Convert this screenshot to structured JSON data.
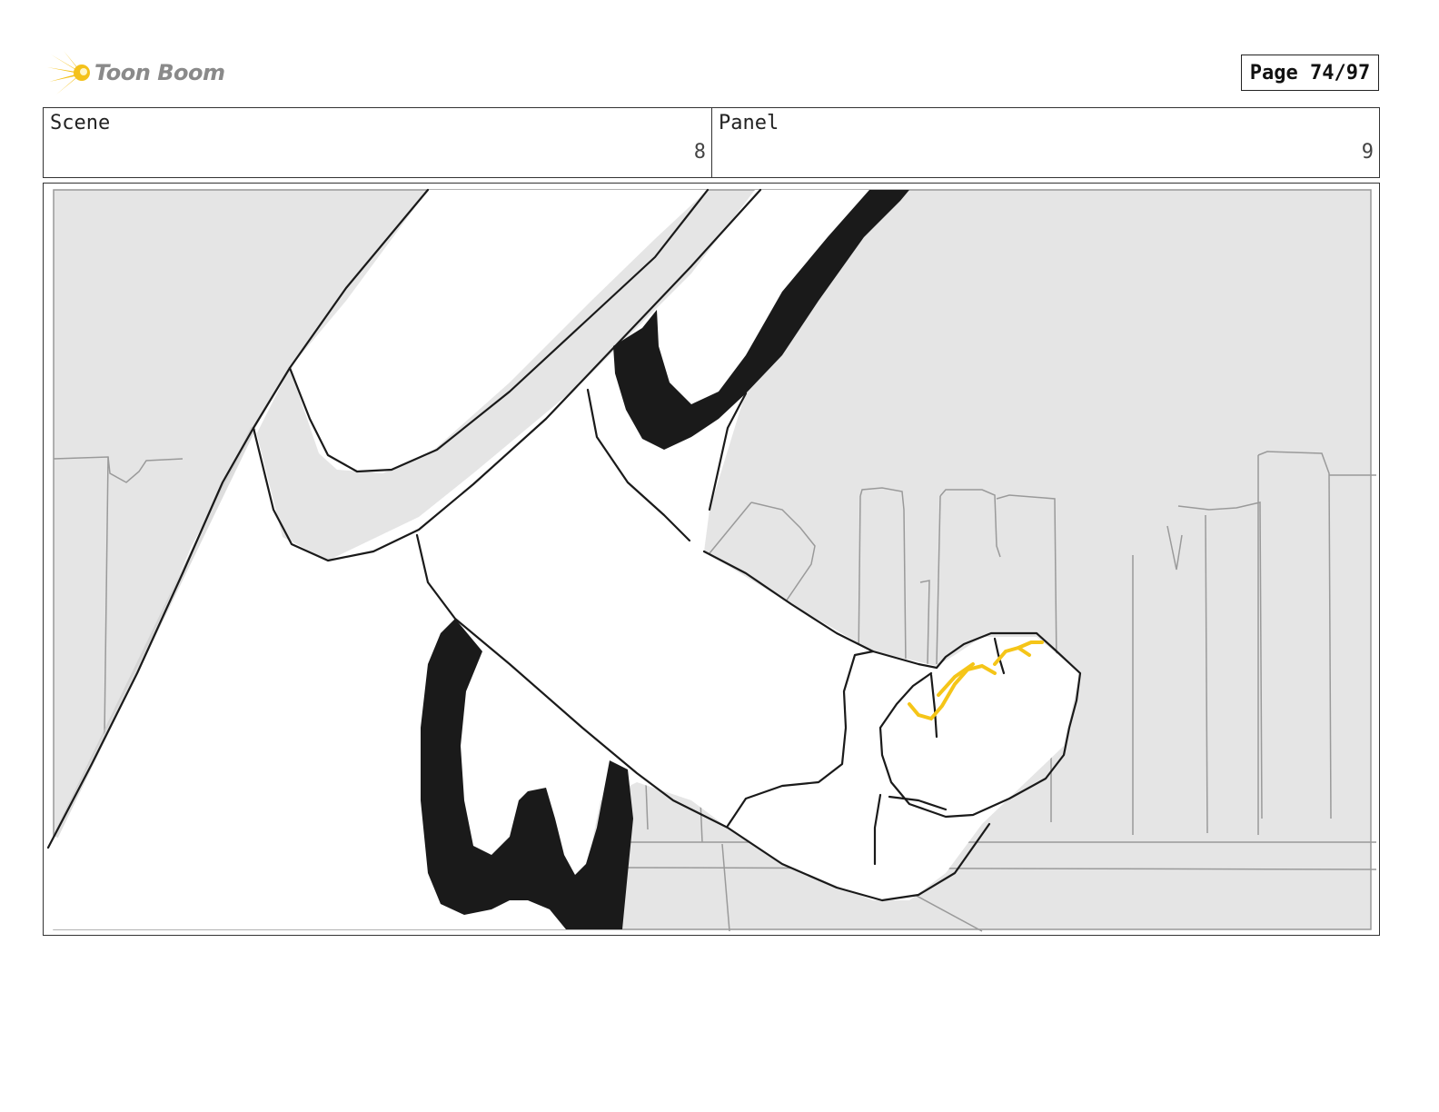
{
  "header": {
    "logo_text": "Toon Boom",
    "page_label": "Page 74/97"
  },
  "info": {
    "scene_label": "Scene",
    "scene_value": "8",
    "panel_label": "Panel",
    "panel_value": "9"
  },
  "colors": {
    "logo_accent": "#f4c11a",
    "ring_highlight": "#f5c518",
    "background_fill": "#e5e5e5",
    "ink": "#1a1a1a"
  },
  "artwork": {
    "icon": "storyboard-panel-sketch"
  }
}
